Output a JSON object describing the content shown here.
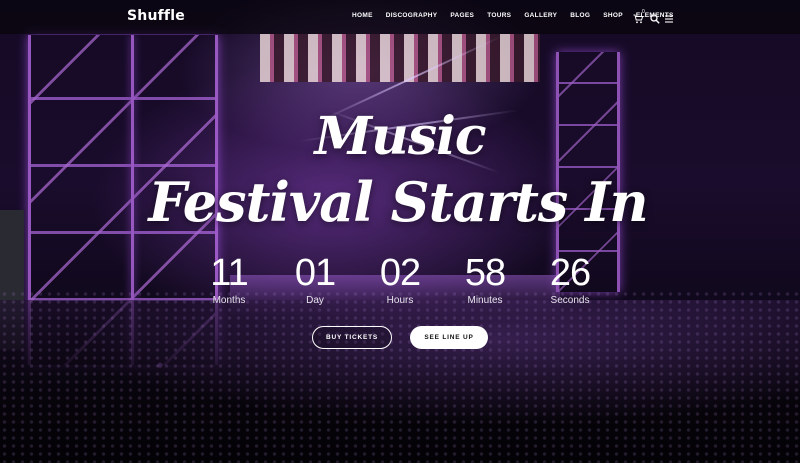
{
  "brand": {
    "name": "Shuffle"
  },
  "nav": {
    "items": [
      {
        "label": "HOME"
      },
      {
        "label": "DISCOGRAPHY"
      },
      {
        "label": "PAGES"
      },
      {
        "label": "TOURS"
      },
      {
        "label": "GALLERY"
      },
      {
        "label": "BLOG"
      },
      {
        "label": "SHOP"
      },
      {
        "label": "ELEMENTS"
      }
    ],
    "icons": [
      "cart-icon",
      "search-icon",
      "menu-icon"
    ],
    "cart_count": "0"
  },
  "hero": {
    "title_line1": "Music",
    "title_line2": "Festival Starts In",
    "countdown": [
      {
        "value": "11",
        "label": "Months"
      },
      {
        "value": "01",
        "label": "Day"
      },
      {
        "value": "02",
        "label": "Hours"
      },
      {
        "value": "58",
        "label": "Minutes"
      },
      {
        "value": "26",
        "label": "Seconds"
      }
    ],
    "buttons": {
      "buy_tickets": "BUY TICKETS",
      "see_line_up": "SEE LINE UP"
    }
  },
  "colors": {
    "accent_purple": "#c070f0",
    "button_text_dark": "#111111",
    "text": "#ffffff"
  }
}
